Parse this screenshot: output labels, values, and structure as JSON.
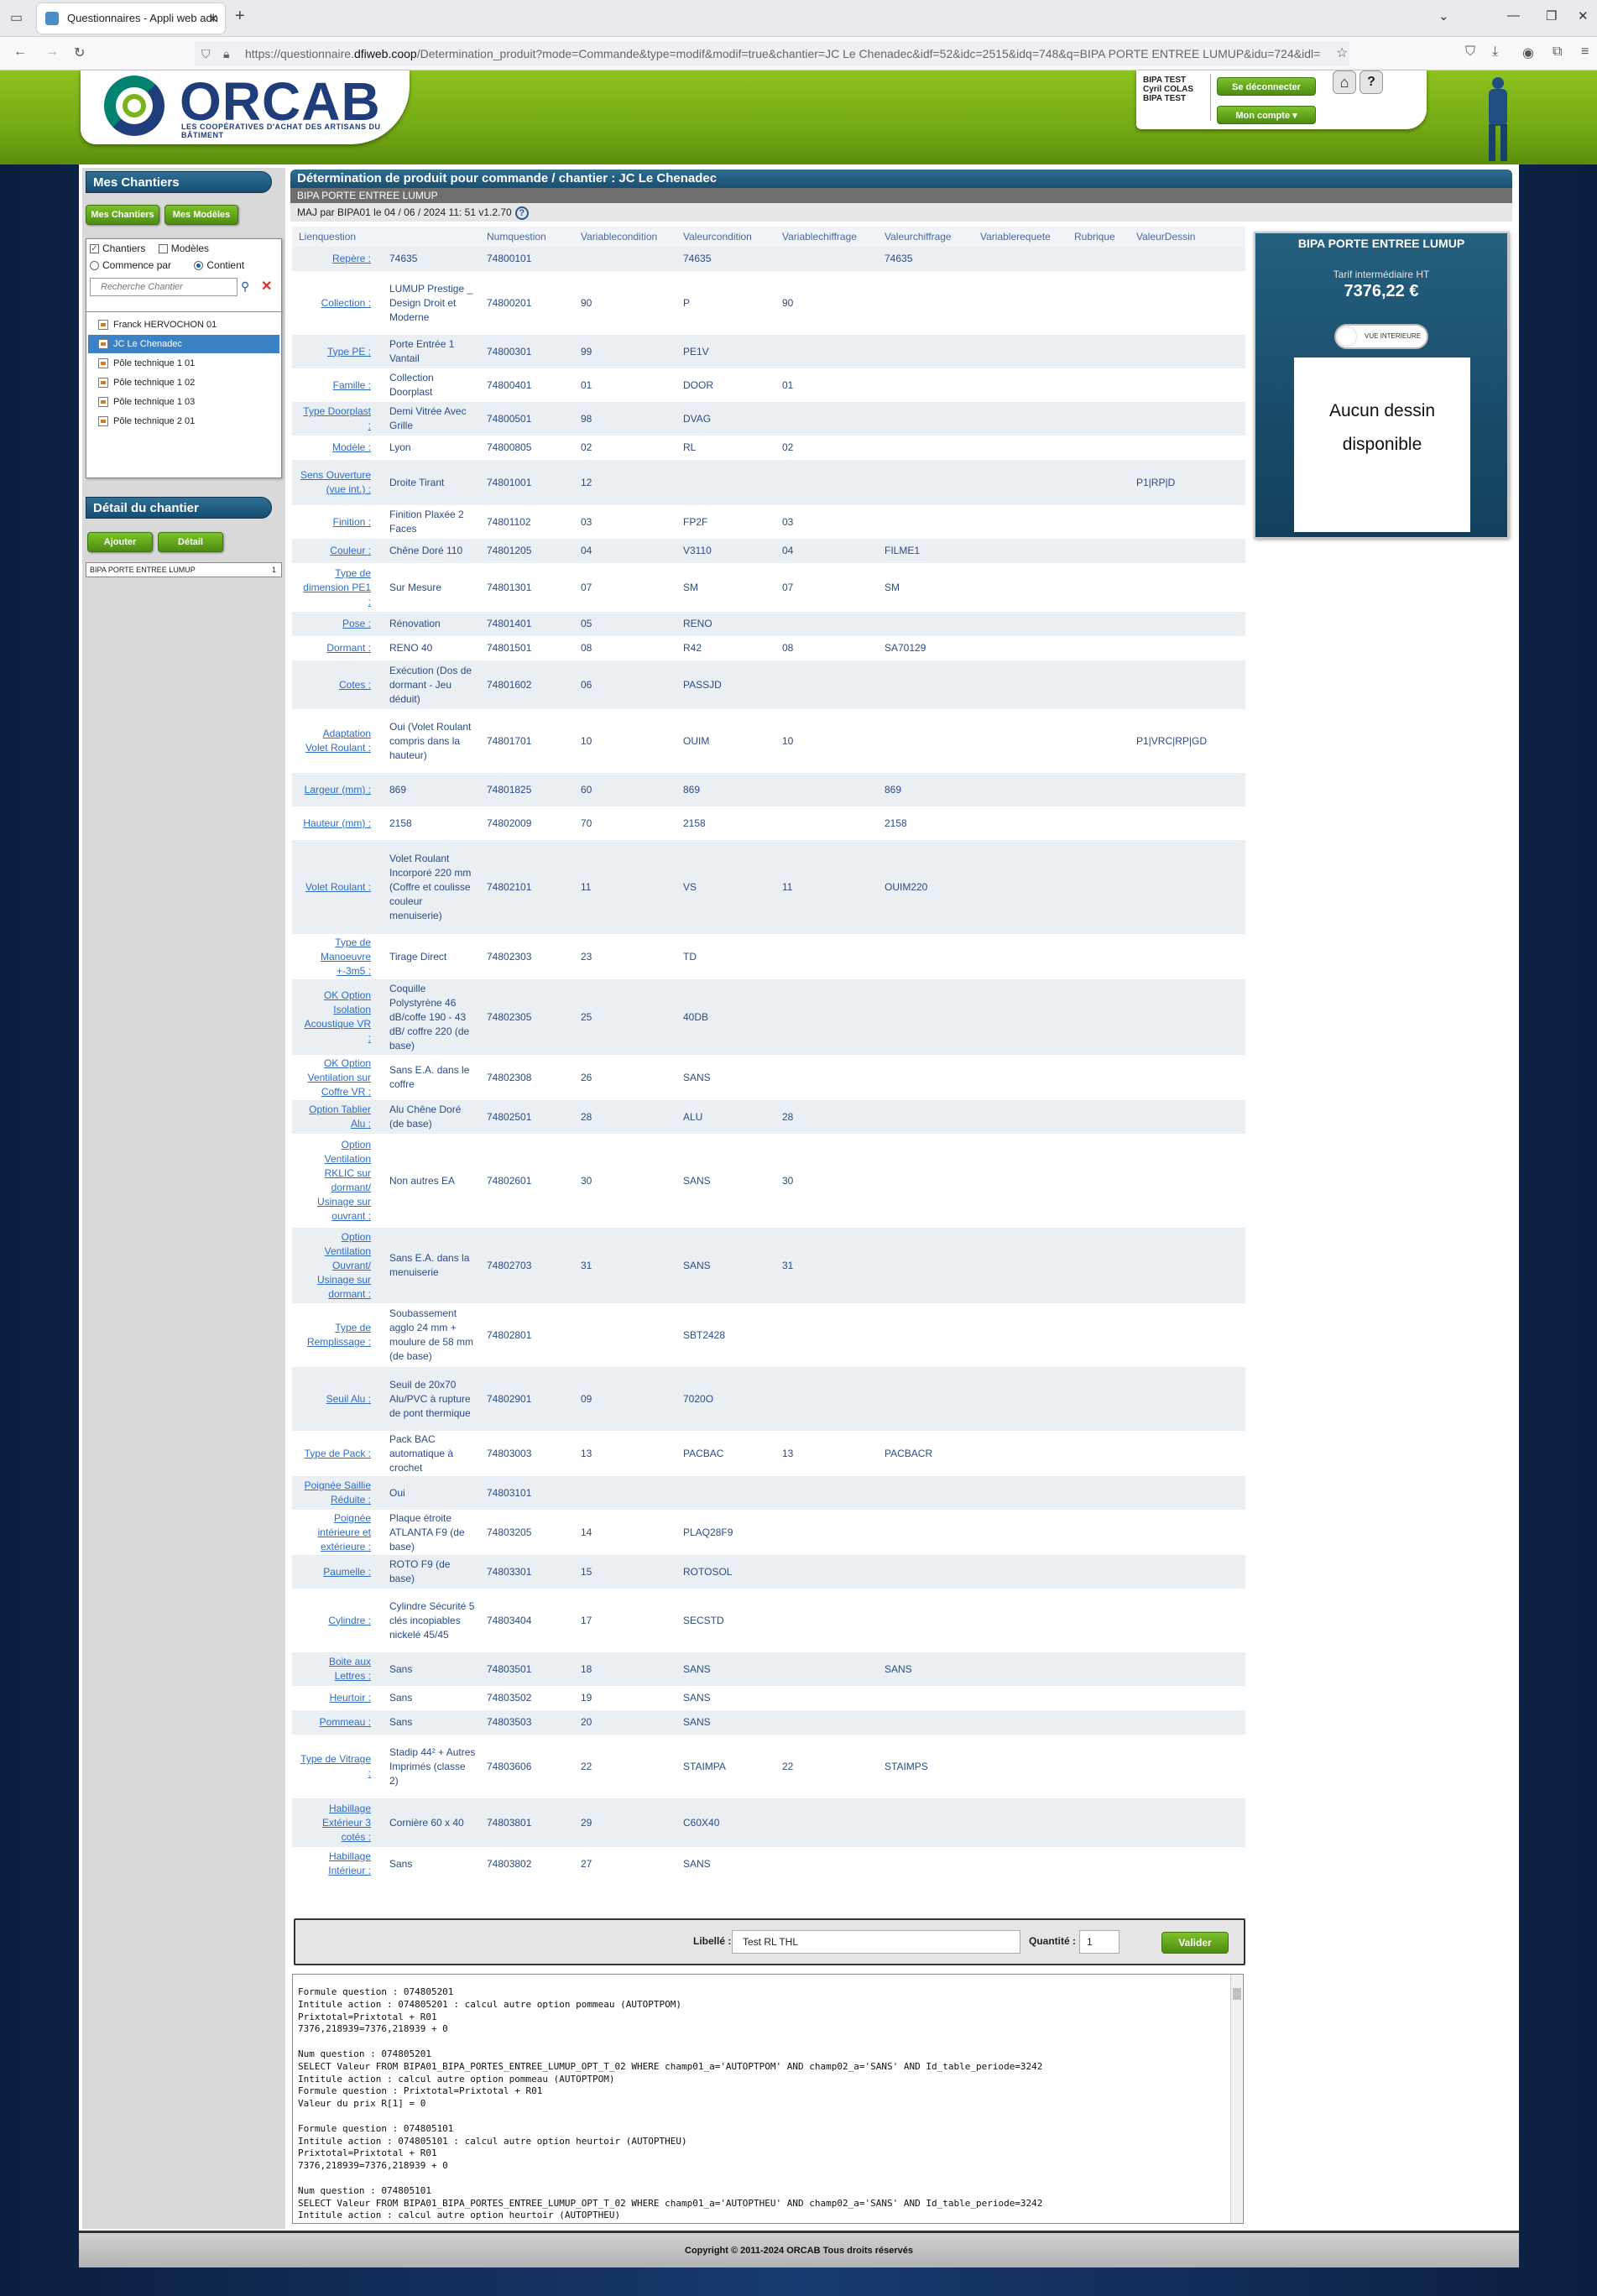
{
  "browser": {
    "tab_title": "Questionnaires - Appli web adh",
    "url_prefix": "https://questionnaire.",
    "url_domain": "dfiweb.coop",
    "url_rest": "/Determination_produit?mode=Commande&type=modif&modif=true&chantier=JC Le Chenadec&idf=52&idc=2515&idq=748&q=BIPA PORTE ENTREE LUMUP&idu=724&idl="
  },
  "header": {
    "logo_text": "ORCAB",
    "logo_tagline": "LES COOPÉRATIVES D'ACHAT DES ARTISANS DU BÂTIMENT",
    "user_line1": "BIPA TEST",
    "user_line2": "Cyril COLAS",
    "user_line3": "BIPA TEST",
    "logout_label": "Se déconnecter",
    "account_label": "Mon compte",
    "help_label": "?"
  },
  "sidebar": {
    "title": "Mes Chantiers",
    "btn_chantiers": "Mes Chantiers",
    "btn_modeles": "Mes Modèles",
    "chk_chantiers": "Chantiers",
    "chk_modeles": "Modèles",
    "radio_commence": "Commence par",
    "radio_contient": "Contient",
    "search_placeholder": "Recherche Chantier",
    "chantiers": [
      "Franck HERVOCHON 01",
      "JC Le Chenadec",
      "Pôle technique 1 01",
      "Pôle technique 1 02",
      "Pôle technique 1 03",
      "Pôle technique 2 01"
    ],
    "detail_title": "Détail du chantier",
    "btn_ajouter": "Ajouter",
    "btn_detail": "Détail",
    "detail_item": "BIPA PORTE ENTREE LUMUP",
    "detail_qty": "1"
  },
  "main": {
    "title": "Détermination de produit pour commande / chantier : JC Le Chenadec",
    "product": "BIPA PORTE ENTREE LUMUP",
    "maj": "MAJ par BIPA01 le 04 / 06 / 2024 11: 51 v1.2.70",
    "columns": [
      "Lienquestion",
      "",
      "Numquestion",
      "Variablecondition",
      "Valeurcondition",
      "Variablechiffrage",
      "Valeurchiffrage",
      "Variablerequete",
      "Rubrique",
      "ValeurDessin"
    ],
    "rows": [
      {
        "lien": "Repère :",
        "valeur": "74635",
        "num": "74800101",
        "varc": "",
        "valc": "74635",
        "varch": "",
        "valch": "74635",
        "dessin": ""
      },
      {
        "lien": "Collection :",
        "valeur": "LUMUP Prestige _ Design Droit et Moderne",
        "num": "74800201",
        "varc": "90",
        "valc": "P",
        "varch": "90",
        "valch": "",
        "dessin": ""
      },
      {
        "lien": "Type PE :",
        "valeur": "Porte Entrée 1 Vantail",
        "num": "74800301",
        "varc": "99",
        "valc": "PE1V",
        "varch": "",
        "valch": "",
        "dessin": ""
      },
      {
        "lien": "Famille :",
        "valeur": "Collection Doorplast",
        "num": "74800401",
        "varc": "01",
        "valc": "DOOR",
        "varch": "01",
        "valch": "",
        "dessin": ""
      },
      {
        "lien": "Type Doorplast :",
        "valeur": "Demi Vitrée Avec Grille",
        "num": "74800501",
        "varc": "98",
        "valc": "DVAG",
        "varch": "",
        "valch": "",
        "dessin": ""
      },
      {
        "lien": "Modèle :",
        "valeur": "Lyon",
        "num": "74800805",
        "varc": "02",
        "valc": "RL",
        "varch": "02",
        "valch": "",
        "dessin": ""
      },
      {
        "lien": "Sens Ouverture (vue int.) :",
        "valeur": "Droite Tirant",
        "num": "74801001",
        "varc": "12",
        "valc": "",
        "varch": "",
        "valch": "",
        "dessin": "P1|RP|D"
      },
      {
        "lien": "Finition :",
        "valeur": "Finition Plaxée 2 Faces",
        "num": "74801102",
        "varc": "03",
        "valc": "FP2F",
        "varch": "03",
        "valch": "",
        "dessin": ""
      },
      {
        "lien": "Couleur :",
        "valeur": "Chêne Doré 110",
        "num": "74801205",
        "varc": "04",
        "valc": "V3110",
        "varch": "04",
        "valch": "FILME1",
        "dessin": ""
      },
      {
        "lien": "Type de dimension PE1 :",
        "valeur": "Sur Mesure",
        "num": "74801301",
        "varc": "07",
        "valc": "SM",
        "varch": "07",
        "valch": "SM",
        "dessin": ""
      },
      {
        "lien": "Pose :",
        "valeur": "Rénovation",
        "num": "74801401",
        "varc": "05",
        "valc": "RENO",
        "varch": "",
        "valch": "",
        "dessin": ""
      },
      {
        "lien": "Dormant :",
        "valeur": "RENO 40",
        "num": "74801501",
        "varc": "08",
        "valc": "R42",
        "varch": "08",
        "valch": "SA70129",
        "dessin": ""
      },
      {
        "lien": "Cotes :",
        "valeur": "Exécution (Dos de dormant - Jeu déduit)",
        "num": "74801602",
        "varc": "06",
        "valc": "PASSJD",
        "varch": "",
        "valch": "",
        "dessin": ""
      },
      {
        "lien": "Adaptation Volet Roulant :",
        "valeur": "Oui (Volet Roulant compris dans la hauteur)",
        "num": "74801701",
        "varc": "10",
        "valc": "OUIM",
        "varch": "10",
        "valch": "",
        "dessin": "P1|VRC|RP|GD"
      },
      {
        "lien": "Largeur (mm) :",
        "valeur": "869",
        "num": "74801825",
        "varc": "60",
        "valc": "869",
        "varch": "",
        "valch": "869",
        "dessin": ""
      },
      {
        "lien": "Hauteur (mm) :",
        "valeur": "2158",
        "num": "74802009",
        "varc": "70",
        "valc": "2158",
        "varch": "",
        "valch": "2158",
        "dessin": ""
      },
      {
        "lien": "Volet Roulant :",
        "valeur": "Volet Roulant Incorporé 220 mm (Coffre et coulisse couleur menuiserie)",
        "num": "74802101",
        "varc": "11",
        "valc": "VS",
        "varch": "11",
        "valch": "OUIM220",
        "dessin": ""
      },
      {
        "lien": "Type de Manoeuvre +-3m5 :",
        "valeur": "Tirage Direct",
        "num": "74802303",
        "varc": "23",
        "valc": "TD",
        "varch": "",
        "valch": "",
        "dessin": ""
      },
      {
        "lien": "OK Option Isolation Acoustique VR :",
        "valeur": "Coquille Polystyrène 46 dB/coffe 190 - 43 dB/ coffre 220 (de base)",
        "num": "74802305",
        "varc": "25",
        "valc": "40DB",
        "varch": "",
        "valch": "",
        "dessin": ""
      },
      {
        "lien": "OK Option Ventilation sur Coffre VR :",
        "valeur": "Sans E.A. dans le coffre",
        "num": "74802308",
        "varc": "26",
        "valc": "SANS",
        "varch": "",
        "valch": "",
        "dessin": ""
      },
      {
        "lien": "Option Tablier Alu :",
        "valeur": "Alu Chêne Doré (de base)",
        "num": "74802501",
        "varc": "28",
        "valc": "ALU",
        "varch": "28",
        "valch": "",
        "dessin": ""
      },
      {
        "lien": "Option Ventilation RKLIC sur dormant/ Usinage sur ouvrant :",
        "valeur": "Non autres EA",
        "num": "74802601",
        "varc": "30",
        "valc": "SANS",
        "varch": "30",
        "valch": "",
        "dessin": ""
      },
      {
        "lien": "Option Ventilation Ouvrant/ Usinage sur dormant :",
        "valeur": "Sans E.A. dans la menuiserie",
        "num": "74802703",
        "varc": "31",
        "valc": "SANS",
        "varch": "31",
        "valch": "",
        "dessin": ""
      },
      {
        "lien": "Type de Remplissage :",
        "valeur": "Soubassement agglo 24 mm + moulure de 58 mm (de base)",
        "num": "74802801",
        "varc": "",
        "valc": "SBT2428",
        "varch": "",
        "valch": "",
        "dessin": ""
      },
      {
        "lien": "Seuil Alu :",
        "valeur": "Seuil de 20x70 Alu/PVC à rupture de pont thermique",
        "num": "74802901",
        "varc": "09",
        "valc": "7020O",
        "varch": "",
        "valch": "",
        "dessin": ""
      },
      {
        "lien": "Type de Pack :",
        "valeur": "Pack BAC automatique à crochet",
        "num": "74803003",
        "varc": "13",
        "valc": "PACBAC",
        "varch": "13",
        "valch": "PACBACR",
        "dessin": ""
      },
      {
        "lien": "Poignée Saillie Réduite :",
        "valeur": "Oui",
        "num": "74803101",
        "varc": "",
        "valc": "",
        "varch": "",
        "valch": "",
        "dessin": ""
      },
      {
        "lien": "Poignée intérieure et extérieure :",
        "valeur": "Plaque étroite ATLANTA F9 (de base)",
        "num": "74803205",
        "varc": "14",
        "valc": "PLAQ28F9",
        "varch": "",
        "valch": "",
        "dessin": ""
      },
      {
        "lien": "Paumelle :",
        "valeur": "ROTO F9 (de base)",
        "num": "74803301",
        "varc": "15",
        "valc": "ROTOSOL",
        "varch": "",
        "valch": "",
        "dessin": ""
      },
      {
        "lien": "Cylindre :",
        "valeur": "Cylindre Sécurité 5 clés incopiables nickelé 45/45",
        "num": "74803404",
        "varc": "17",
        "valc": "SECSTD",
        "varch": "",
        "valch": "",
        "dessin": ""
      },
      {
        "lien": "Boite aux Lettres :",
        "valeur": "Sans",
        "num": "74803501",
        "varc": "18",
        "valc": "SANS",
        "varch": "",
        "valch": "SANS",
        "dessin": ""
      },
      {
        "lien": "Heurtoir :",
        "valeur": "Sans",
        "num": "74803502",
        "varc": "19",
        "valc": "SANS",
        "varch": "",
        "valch": "",
        "dessin": ""
      },
      {
        "lien": "Pommeau :",
        "valeur": "Sans",
        "num": "74803503",
        "varc": "20",
        "valc": "SANS",
        "varch": "",
        "valch": "",
        "dessin": ""
      },
      {
        "lien": "Type de Vitrage :",
        "valeur": "Stadip 44² + Autres Imprimés (classe 2)",
        "num": "74803606",
        "varc": "22",
        "valc": "STAIMPA",
        "varch": "22",
        "valch": "STAIMPS",
        "dessin": ""
      },
      {
        "lien": "Habillage Extérieur 3 cotés :",
        "valeur": "Cornière 60 x 40",
        "num": "74803801",
        "varc": "29",
        "valc": "C60X40",
        "varch": "",
        "valch": "",
        "dessin": ""
      },
      {
        "lien": "Habillage Intérieur :",
        "valeur": "Sans",
        "num": "74803802",
        "varc": "27",
        "valc": "SANS",
        "varch": "",
        "valch": "",
        "dessin": ""
      }
    ],
    "libelle_label": "Libellé :",
    "libelle_value": "Test RL THL",
    "quantite_label": "Quantité :",
    "quantite_value": "1",
    "valider_label": "Valider",
    "log": "Formule question : 074805201\nIntitule action : 074805201 : calcul autre option pommeau (AUTOPTPOM)\nPrixtotal=Prixtotal + R01\n7376,218939=7376,218939 + 0\n\nNum question : 074805201\nSELECT Valeur FROM BIPA01_BIPA_PORTES_ENTREE_LUMUP_OPT_T_02 WHERE champ01_a='AUTOPTPOM' AND champ02_a='SANS' AND Id_table_periode=3242\nIntitule action : calcul autre option pommeau (AUTOPTPOM)\nFormule question : Prixtotal=Prixtotal + R01\nValeur du prix R[1] = 0\n\nFormule question : 074805101\nIntitule action : 074805101 : calcul autre option heurtoir (AUTOPTHEU)\nPrixtotal=Prixtotal + R01\n7376,218939=7376,218939 + 0\n\nNum question : 074805101\nSELECT Valeur FROM BIPA01_BIPA_PORTES_ENTREE_LUMUP_OPT_T_02 WHERE champ01_a='AUTOPTHEU' AND champ02_a='SANS' AND Id_table_periode=3242\nIntitule action : calcul autre option heurtoir (AUTOPTHEU)"
  },
  "preview": {
    "title": "BIPA PORTE ENTREE LUMUP",
    "tarif_label": "Tarif intermédiaire HT",
    "tarif_value": "7376,22 €",
    "toggle_label": "VUE INTERIEURE",
    "no_drawing": "Aucun dessin disponible"
  },
  "footer": {
    "copyright": "Copyright © 2011-2024 ORCAB Tous droits réservés"
  }
}
